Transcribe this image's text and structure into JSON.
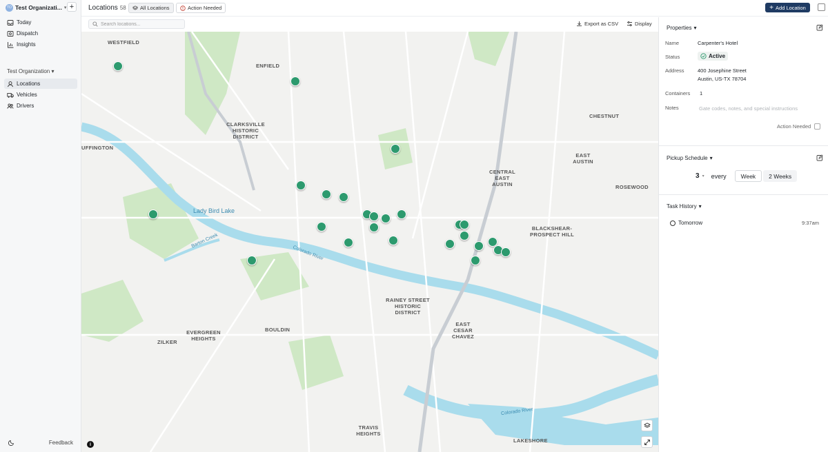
{
  "sidebar": {
    "org_avatar": "TO",
    "org_name": "Test Organizati...",
    "add": "+",
    "nav": [
      {
        "label": "Today",
        "icon": "inbox-icon"
      },
      {
        "label": "Dispatch",
        "icon": "route-icon"
      },
      {
        "label": "Insights",
        "icon": "chart-icon"
      }
    ],
    "section": "Test Organization",
    "sub_nav": [
      {
        "label": "Locations",
        "icon": "location-icon",
        "active": true
      },
      {
        "label": "Vehicles",
        "icon": "truck-icon"
      },
      {
        "label": "Drivers",
        "icon": "users-icon"
      }
    ],
    "feedback": "Feedback"
  },
  "header": {
    "title": "Locations",
    "count": "58",
    "filter_all": "All Locations",
    "filter_action": "Action Needed",
    "add_location": "Add Location"
  },
  "toolbar": {
    "search_placeholder": "Search locations...",
    "export": "Export as CSV",
    "display": "Display"
  },
  "map": {
    "labels": [
      "WESTFIELD",
      "ENFIELD",
      "CLARKSVILLE HISTORIC DISTRICT",
      "UFFINGTON",
      "CENTRAL EAST AUSTIN",
      "ROSEWOOD",
      "CHESTNUT",
      "EAST AUSTIN",
      "BLACKSHEAR-PROSPECT HILL",
      "RAINEY STREET HISTORIC DISTRICT",
      "EAST CESAR CHAVEZ",
      "BOULDIN",
      "ZILKER",
      "EVERGREEN HEIGHTS",
      "TRAVIS HEIGHTS",
      "LAKESHORE"
    ],
    "water": {
      "lake": "Lady Bird Lake",
      "river": "Colorado River",
      "creek": "Barton Creek"
    }
  },
  "properties": {
    "heading": "Properties",
    "name_label": "Name",
    "name": "Carpenter's Hotel",
    "status_label": "Status",
    "status": "Active",
    "address_label": "Address",
    "address_line1": "400 Josephine Street",
    "address_line2": "Austin, US-TX 78704",
    "containers_label": "Containers",
    "containers": "1",
    "notes_label": "Notes",
    "notes_placeholder": "Gate codes, notes, and special instructions",
    "action_needed": "Action Needed"
  },
  "schedule": {
    "heading": "Pickup Schedule",
    "count": "3",
    "every": "every",
    "option_week": "Week",
    "option_2weeks": "2 Weeks"
  },
  "history": {
    "heading": "Task History",
    "item": "Tomorrow",
    "time": "9:37am"
  },
  "colors": {
    "pin": "#2d9a6e",
    "primary": "#1f3b63",
    "water": "#a9dcec",
    "park": "#cfe8c5"
  }
}
